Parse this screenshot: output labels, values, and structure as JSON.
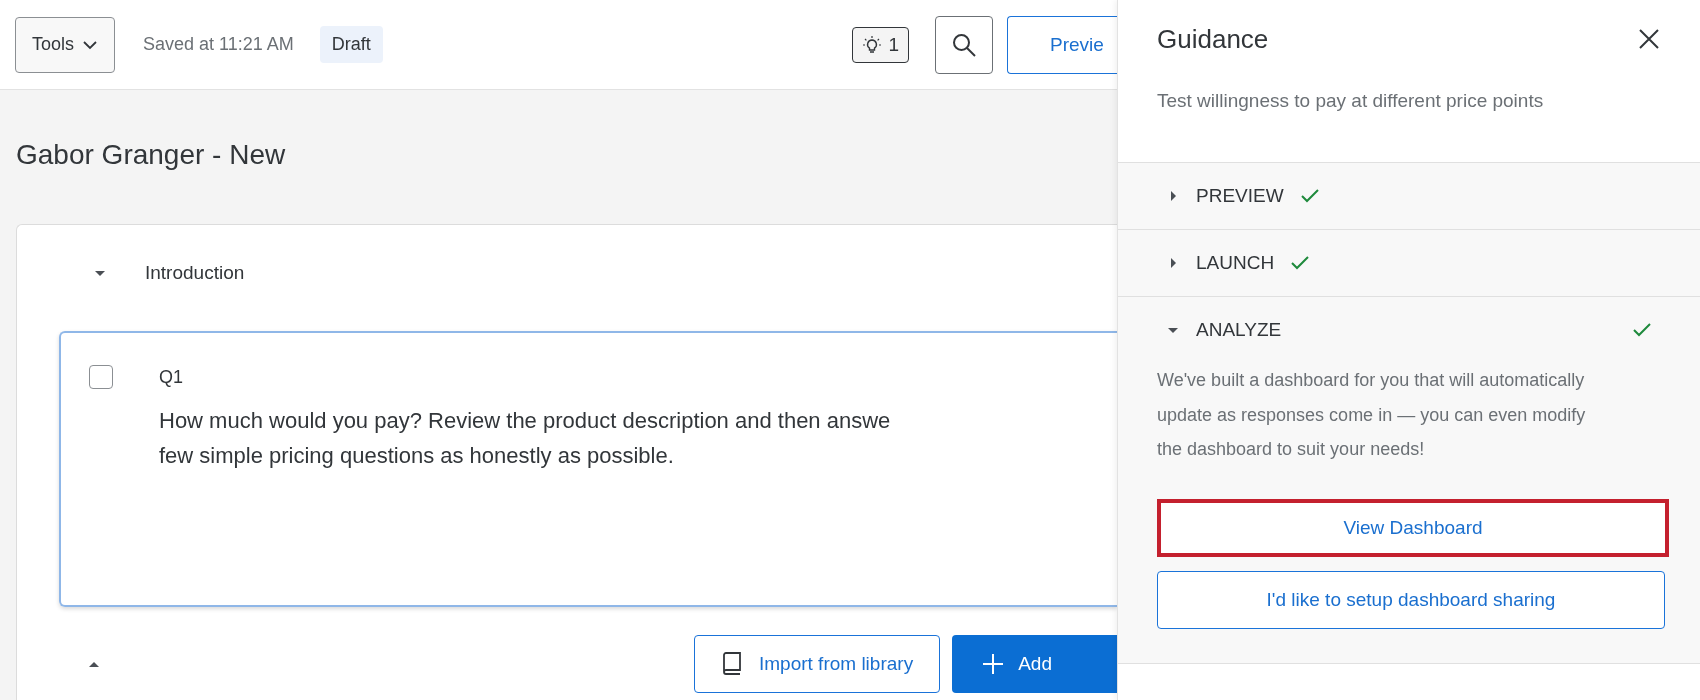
{
  "toolbar": {
    "tools_menu": "Tools",
    "saved_status": "Saved at 11:21 AM",
    "status_badge": "Draft",
    "ideas_count": "1",
    "preview_button": "Previe"
  },
  "survey": {
    "title": "Gabor Granger - New",
    "block": {
      "name": "Introduction",
      "expanded": true,
      "question": {
        "number": "Q1",
        "checked": false,
        "text_lines": [
          "How much would you pay? Review the product description and then answe",
          "few simple pricing questions as honestly as possible."
        ]
      }
    },
    "import_button": "Import from library",
    "add_button": "Add"
  },
  "guidance": {
    "title": "Guidance",
    "subtitle": "Test willingness to pay at different price points",
    "sections": [
      {
        "label": "PREVIEW",
        "expanded": false,
        "done": true
      },
      {
        "label": "LAUNCH",
        "expanded": false,
        "done": true
      },
      {
        "label": "ANALYZE",
        "expanded": true,
        "done": true,
        "body": "We've built a dashboard for you that will automatically update as responses come in — you can even modify the dashboard to suit your needs!",
        "actions": [
          {
            "label": "View Dashboard",
            "highlighted": true
          },
          {
            "label": "I'd like to setup dashboard sharing",
            "highlighted": false
          }
        ]
      }
    ]
  }
}
